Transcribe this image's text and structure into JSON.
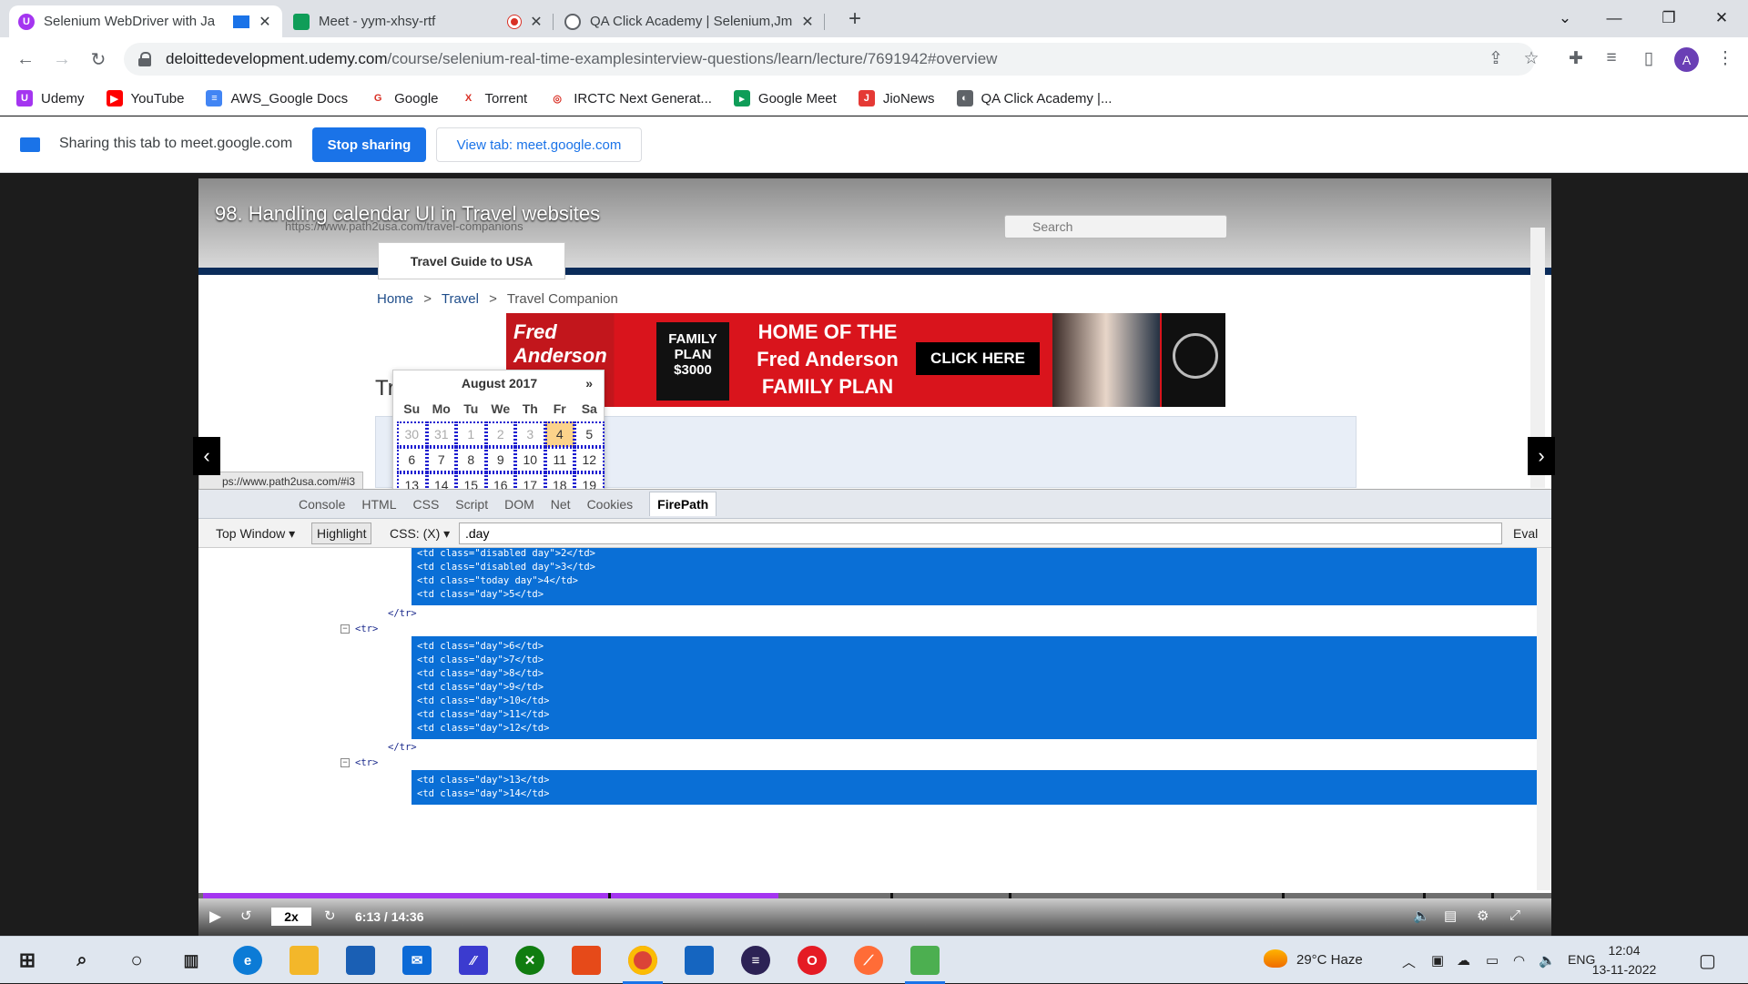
{
  "tabs": [
    {
      "title": "Selenium WebDriver with Ja",
      "favicon_color": "#a435f0",
      "favicon_glyph": "U",
      "active": true
    },
    {
      "title": "Meet - yym-xhsy-rtf",
      "favicon_color": "#0f9d58",
      "favicon_glyph": "",
      "active": false
    },
    {
      "title": "QA Click Academy | Selenium,Jm",
      "favicon_color": "#5f6368",
      "favicon_glyph": "",
      "active": false
    }
  ],
  "address": {
    "host": "deloittedevelopment.udemy.com",
    "path": "/course/selenium-real-time-examplesinterview-questions/learn/lecture/7691942#overview"
  },
  "profile_initial": "A",
  "bookmarks": [
    {
      "label": "Udemy",
      "color": "#a435f0",
      "glyph": "U"
    },
    {
      "label": "YouTube",
      "color": "#ff0000",
      "glyph": "▶"
    },
    {
      "label": "AWS_Google Docs",
      "color": "#4285f4",
      "glyph": "≡"
    },
    {
      "label": "Google",
      "color": "#ffffff",
      "glyph": "G"
    },
    {
      "label": "Torrent",
      "color": "#ffffff",
      "glyph": "X"
    },
    {
      "label": "IRCTC Next Generat...",
      "color": "#ffffff",
      "glyph": "◎"
    },
    {
      "label": "Google Meet",
      "color": "#0f9d58",
      "glyph": "▸"
    },
    {
      "label": "JioNews",
      "color": "#e53935",
      "glyph": "J"
    },
    {
      "label": "QA Click Academy |...",
      "color": "#5f6368",
      "glyph": "◐"
    }
  ],
  "sharing": {
    "text": "Sharing this tab to meet.google.com",
    "stop_label": "Stop sharing",
    "view_label": "View tab: meet.google.com"
  },
  "video": {
    "title": "98. Handling calendar UI in Travel websites",
    "current_time": "6:13 / 14:36",
    "speed": "2x",
    "progress_fraction": 0.427
  },
  "inner_browser": {
    "url": "https://www.path2usa.com/travel-companions",
    "search_placeholder": "Search",
    "travel_guide": "Travel Guide to USA",
    "breadcrumb": [
      "Home",
      ">",
      "Travel",
      ">",
      "Travel Companion"
    ],
    "status_url": "ps://www.path2usa.com/#i3",
    "heading_fragment": "Tr"
  },
  "ad": {
    "brand": "Fred Anderson NISSAN",
    "family": "FAMILY PLAN $3000",
    "headline": "HOME OF THE Fred Anderson FAMILY PLAN",
    "cta": "CLICK HERE"
  },
  "calendar": {
    "month": "August 2017",
    "next": "»",
    "weekdays": [
      "Su",
      "Mo",
      "Tu",
      "We",
      "Th",
      "Fr",
      "Sa"
    ],
    "weeks": [
      [
        {
          "d": "30",
          "s": "disabled"
        },
        {
          "d": "31",
          "s": "disabled"
        },
        {
          "d": "1",
          "s": "disabled"
        },
        {
          "d": "2",
          "s": "disabled"
        },
        {
          "d": "3",
          "s": "disabled"
        },
        {
          "d": "4",
          "s": "today"
        },
        {
          "d": "5",
          "s": ""
        }
      ],
      [
        {
          "d": "6",
          "s": ""
        },
        {
          "d": "7",
          "s": ""
        },
        {
          "d": "8",
          "s": ""
        },
        {
          "d": "9",
          "s": ""
        },
        {
          "d": "10",
          "s": ""
        },
        {
          "d": "11",
          "s": ""
        },
        {
          "d": "12",
          "s": ""
        }
      ],
      [
        {
          "d": "13",
          "s": ""
        },
        {
          "d": "14",
          "s": ""
        },
        {
          "d": "15",
          "s": ""
        },
        {
          "d": "16",
          "s": ""
        },
        {
          "d": "17",
          "s": ""
        },
        {
          "d": "18",
          "s": ""
        },
        {
          "d": "19",
          "s": ""
        }
      ]
    ]
  },
  "firebug": {
    "tabs": [
      "Console",
      "HTML",
      "CSS",
      "Script",
      "DOM",
      "Net",
      "Cookies",
      "FirePath"
    ],
    "active_tab": "FirePath",
    "top_window": "Top Window",
    "highlight": "Highlight",
    "css_label": "CSS: (X)",
    "selector": ".day",
    "eval": "Eval",
    "code_blocks": [
      [
        "<td class=\"disabled day\">2</td>",
        "<td class=\"disabled day\">3</td>",
        "<td class=\"today day\">4</td>",
        "<td class=\"day\">5</td>"
      ],
      [
        "<td class=\"day\">6</td>",
        "<td class=\"day\">7</td>",
        "<td class=\"day\">8</td>",
        "<td class=\"day\">9</td>",
        "<td class=\"day\">10</td>",
        "<td class=\"day\">11</td>",
        "<td class=\"day\">12</td>"
      ],
      [
        "<td class=\"day\">13</td>",
        "<td class=\"day\">14</td>"
      ]
    ],
    "tr_close": "</tr>",
    "tr_open": "<tr>"
  },
  "taskbar": {
    "weather": "29°C Haze",
    "language": "ENG",
    "time": "12:04",
    "date": "13-11-2022"
  },
  "colors": {
    "udemy_purple": "#a435f0",
    "chrome_blue": "#1a73e8",
    "firebug_highlight": "#0a6fd6"
  }
}
